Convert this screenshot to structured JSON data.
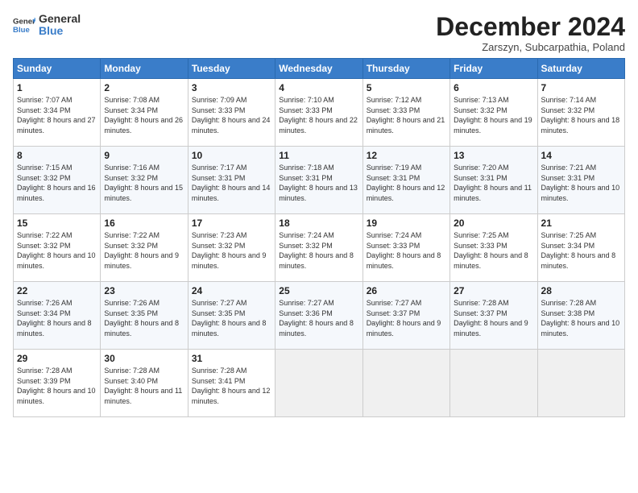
{
  "logo": {
    "general": "General",
    "blue": "Blue"
  },
  "header": {
    "month": "December 2024",
    "subtitle": "Zarszyn, Subcarpathia, Poland"
  },
  "weekdays": [
    "Sunday",
    "Monday",
    "Tuesday",
    "Wednesday",
    "Thursday",
    "Friday",
    "Saturday"
  ],
  "weeks": [
    [
      {
        "day": 1,
        "sunrise": "7:07 AM",
        "sunset": "3:34 PM",
        "daylight": "8 hours and 27 minutes."
      },
      {
        "day": 2,
        "sunrise": "7:08 AM",
        "sunset": "3:34 PM",
        "daylight": "8 hours and 26 minutes."
      },
      {
        "day": 3,
        "sunrise": "7:09 AM",
        "sunset": "3:33 PM",
        "daylight": "8 hours and 24 minutes."
      },
      {
        "day": 4,
        "sunrise": "7:10 AM",
        "sunset": "3:33 PM",
        "daylight": "8 hours and 22 minutes."
      },
      {
        "day": 5,
        "sunrise": "7:12 AM",
        "sunset": "3:33 PM",
        "daylight": "8 hours and 21 minutes."
      },
      {
        "day": 6,
        "sunrise": "7:13 AM",
        "sunset": "3:32 PM",
        "daylight": "8 hours and 19 minutes."
      },
      {
        "day": 7,
        "sunrise": "7:14 AM",
        "sunset": "3:32 PM",
        "daylight": "8 hours and 18 minutes."
      }
    ],
    [
      {
        "day": 8,
        "sunrise": "7:15 AM",
        "sunset": "3:32 PM",
        "daylight": "8 hours and 16 minutes."
      },
      {
        "day": 9,
        "sunrise": "7:16 AM",
        "sunset": "3:32 PM",
        "daylight": "8 hours and 15 minutes."
      },
      {
        "day": 10,
        "sunrise": "7:17 AM",
        "sunset": "3:31 PM",
        "daylight": "8 hours and 14 minutes."
      },
      {
        "day": 11,
        "sunrise": "7:18 AM",
        "sunset": "3:31 PM",
        "daylight": "8 hours and 13 minutes."
      },
      {
        "day": 12,
        "sunrise": "7:19 AM",
        "sunset": "3:31 PM",
        "daylight": "8 hours and 12 minutes."
      },
      {
        "day": 13,
        "sunrise": "7:20 AM",
        "sunset": "3:31 PM",
        "daylight": "8 hours and 11 minutes."
      },
      {
        "day": 14,
        "sunrise": "7:21 AM",
        "sunset": "3:31 PM",
        "daylight": "8 hours and 10 minutes."
      }
    ],
    [
      {
        "day": 15,
        "sunrise": "7:22 AM",
        "sunset": "3:32 PM",
        "daylight": "8 hours and 10 minutes."
      },
      {
        "day": 16,
        "sunrise": "7:22 AM",
        "sunset": "3:32 PM",
        "daylight": "8 hours and 9 minutes."
      },
      {
        "day": 17,
        "sunrise": "7:23 AM",
        "sunset": "3:32 PM",
        "daylight": "8 hours and 9 minutes."
      },
      {
        "day": 18,
        "sunrise": "7:24 AM",
        "sunset": "3:32 PM",
        "daylight": "8 hours and 8 minutes."
      },
      {
        "day": 19,
        "sunrise": "7:24 AM",
        "sunset": "3:33 PM",
        "daylight": "8 hours and 8 minutes."
      },
      {
        "day": 20,
        "sunrise": "7:25 AM",
        "sunset": "3:33 PM",
        "daylight": "8 hours and 8 minutes."
      },
      {
        "day": 21,
        "sunrise": "7:25 AM",
        "sunset": "3:34 PM",
        "daylight": "8 hours and 8 minutes."
      }
    ],
    [
      {
        "day": 22,
        "sunrise": "7:26 AM",
        "sunset": "3:34 PM",
        "daylight": "8 hours and 8 minutes."
      },
      {
        "day": 23,
        "sunrise": "7:26 AM",
        "sunset": "3:35 PM",
        "daylight": "8 hours and 8 minutes."
      },
      {
        "day": 24,
        "sunrise": "7:27 AM",
        "sunset": "3:35 PM",
        "daylight": "8 hours and 8 minutes."
      },
      {
        "day": 25,
        "sunrise": "7:27 AM",
        "sunset": "3:36 PM",
        "daylight": "8 hours and 8 minutes."
      },
      {
        "day": 26,
        "sunrise": "7:27 AM",
        "sunset": "3:37 PM",
        "daylight": "8 hours and 9 minutes."
      },
      {
        "day": 27,
        "sunrise": "7:28 AM",
        "sunset": "3:37 PM",
        "daylight": "8 hours and 9 minutes."
      },
      {
        "day": 28,
        "sunrise": "7:28 AM",
        "sunset": "3:38 PM",
        "daylight": "8 hours and 10 minutes."
      }
    ],
    [
      {
        "day": 29,
        "sunrise": "7:28 AM",
        "sunset": "3:39 PM",
        "daylight": "8 hours and 10 minutes."
      },
      {
        "day": 30,
        "sunrise": "7:28 AM",
        "sunset": "3:40 PM",
        "daylight": "8 hours and 11 minutes."
      },
      {
        "day": 31,
        "sunrise": "7:28 AM",
        "sunset": "3:41 PM",
        "daylight": "8 hours and 12 minutes."
      },
      null,
      null,
      null,
      null
    ]
  ]
}
